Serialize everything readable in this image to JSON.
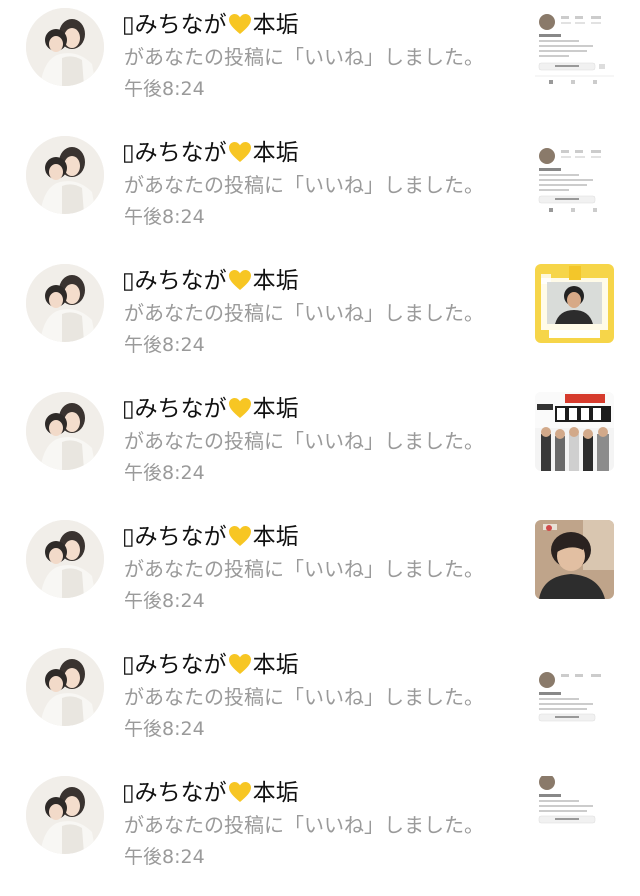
{
  "notifications": [
    {
      "user_name_prefix": "▯みちなが",
      "user_name_suffix": "本垢",
      "message": "があなたの投稿に「いいね」しました。",
      "time": "午後8:24",
      "thumb_kind": "profile"
    },
    {
      "user_name_prefix": "▯みちなが",
      "user_name_suffix": "本垢",
      "message": "があなたの投稿に「いいね」しました。",
      "time": "午後8:24",
      "thumb_kind": "profile"
    },
    {
      "user_name_prefix": "▯みちなが",
      "user_name_suffix": "本垢",
      "message": "があなたの投稿に「いいね」しました。",
      "time": "午後8:24",
      "thumb_kind": "yellow-frame"
    },
    {
      "user_name_prefix": "▯みちなが",
      "user_name_suffix": "本垢",
      "message": "があなたの投稿に「いいね」しました。",
      "time": "午後8:24",
      "thumb_kind": "group-poster"
    },
    {
      "user_name_prefix": "▯みちなが",
      "user_name_suffix": "本垢",
      "message": "があなたの投稿に「いいね」しました。",
      "time": "午後8:24",
      "thumb_kind": "selfie"
    },
    {
      "user_name_prefix": "▯みちなが",
      "user_name_suffix": "本垢",
      "message": "があなたの投稿に「いいね」しました。",
      "time": "午後8:24",
      "thumb_kind": "profile"
    },
    {
      "user_name_prefix": "▯みちなが",
      "user_name_suffix": "本垢",
      "message": "があなたの投稿に「いいね」しました。",
      "time": "午後8:24",
      "thumb_kind": "profile"
    }
  ],
  "icons": {
    "heart": "yellow-heart-icon",
    "avatar": "avatar",
    "thumbnail": "post-thumbnail"
  },
  "colors": {
    "heart": "#f7c623",
    "secondary_text": "#9a9a9a",
    "primary_text": "#111111",
    "thumb_frame_yellow": "#f6d549"
  }
}
